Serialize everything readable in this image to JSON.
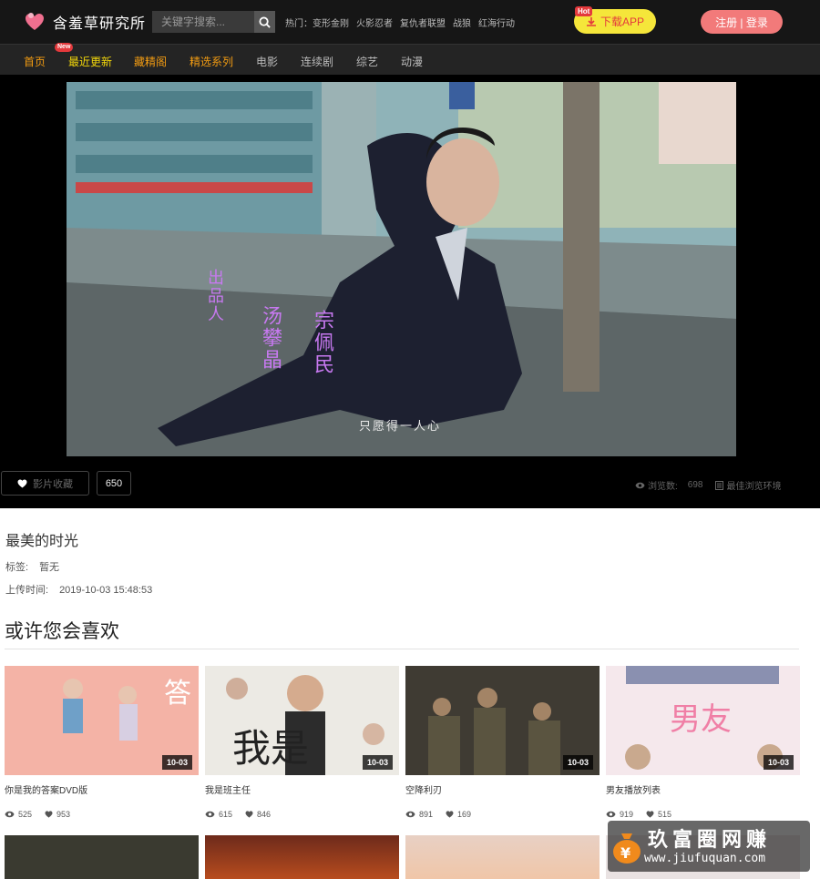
{
  "header": {
    "site_name": "含羞草研究所",
    "search_placeholder": "关键字搜索...",
    "hot_label": "热门：",
    "hot_links": [
      "变形金刚",
      "火影忍者",
      "复仇者联盟",
      "战狼",
      "红海行动"
    ],
    "download_label": "下载APP",
    "hot_tag": "Hot",
    "login_label": "注册 | 登录"
  },
  "nav": {
    "items": [
      "首页",
      "最近更新",
      "藏精阁",
      "精选系列",
      "电影",
      "连续剧",
      "综艺",
      "动漫"
    ],
    "new_tag": "New"
  },
  "player": {
    "subtitle": "只愿得一人心",
    "credit_1": "出品人",
    "credit_2": "汤攀晶",
    "credit_3": "宗佩民",
    "fav_label": "影片收藏",
    "fav_count": "650",
    "views_label": "浏览数:",
    "views_count": "698",
    "best_env_label": "最佳浏览环境"
  },
  "video_info": {
    "title": "最美的时光",
    "tags_label": "标签:",
    "tags_value": "暂无",
    "upload_label": "上传时间:",
    "upload_value": "2019-10-03 15:48:53"
  },
  "recommend": {
    "heading": "或许您会喜欢",
    "cards": [
      {
        "title": "你是我的答案DVD版",
        "date": "10-03",
        "views": "525",
        "likes": "953",
        "color": "#f2a79a"
      },
      {
        "title": "我是班主任",
        "date": "10-03",
        "views": "615",
        "likes": "846",
        "color": "#e8e6e1"
      },
      {
        "title": "空降利刃",
        "date": "10-03",
        "views": "891",
        "likes": "169",
        "color": "#4f4a40"
      },
      {
        "title": "男友播放列表",
        "date": "10-03",
        "views": "919",
        "likes": "515",
        "color": "#f4e4ea"
      }
    ]
  },
  "watermark": {
    "title": "玖富圈网赚",
    "url": "www.jiufuquan.com"
  }
}
